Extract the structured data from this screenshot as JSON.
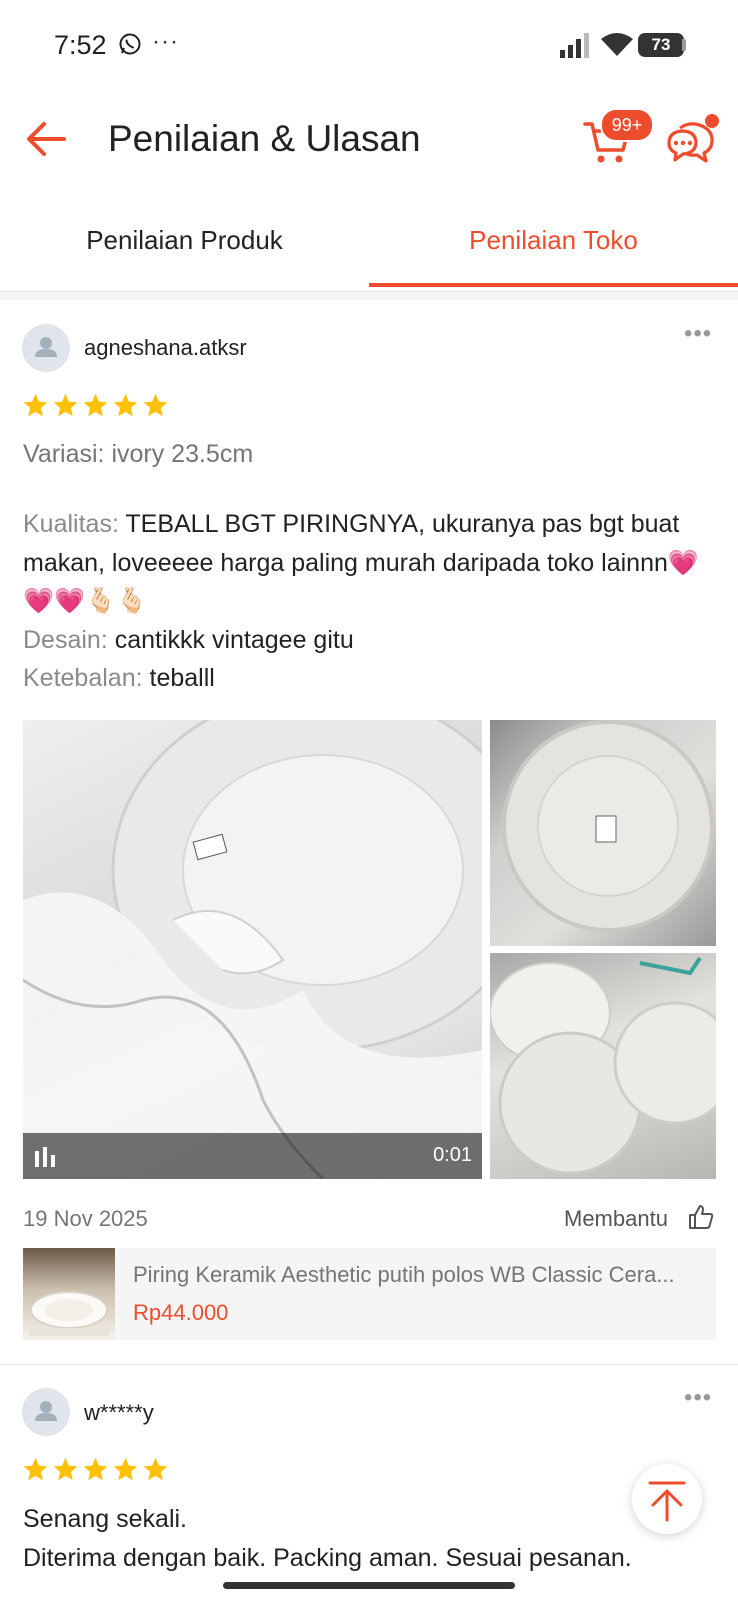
{
  "status_bar": {
    "time": "7:52",
    "overflow": "···",
    "battery": "73",
    "icons": [
      "whatsapp-icon",
      "signal-icon",
      "wifi-icon",
      "battery-icon"
    ]
  },
  "header": {
    "title": "Penilaian & Ulasan",
    "cart_badge": "99+",
    "accent_color": "#ee4d2d"
  },
  "tabs": [
    {
      "label": "Penilaian Produk",
      "active": false
    },
    {
      "label": "Penilaian Toko",
      "active": true
    }
  ],
  "reviews": [
    {
      "username": "agneshana.atksr",
      "rating": 5,
      "variant": "Variasi: ivory 23.5cm",
      "body": [
        {
          "label": "Kualitas:",
          "text": "TEBALL BGT PIRINGNYA, ukuranya pas bgt buat makan, loveeeee harga paling murah daripada toko lainnn💗💗💗🫰🏻🫰🏻"
        },
        {
          "label": "Desain:",
          "text": "cantikkk vintagee gitu"
        },
        {
          "label": "Ketebalan:",
          "text": "teballl"
        }
      ],
      "video_duration": "0:01",
      "date": "19 Nov 2025",
      "helpful_label": "Membantu",
      "product": {
        "name": "Piring Keramik Aesthetic putih polos WB Classic Cera...",
        "price": "Rp44.000"
      }
    },
    {
      "username": "w*****y",
      "rating": 5,
      "line1": "Senang sekali.",
      "line2": "Diterima dengan baik. Packing aman. Sesuai pesanan."
    }
  ]
}
